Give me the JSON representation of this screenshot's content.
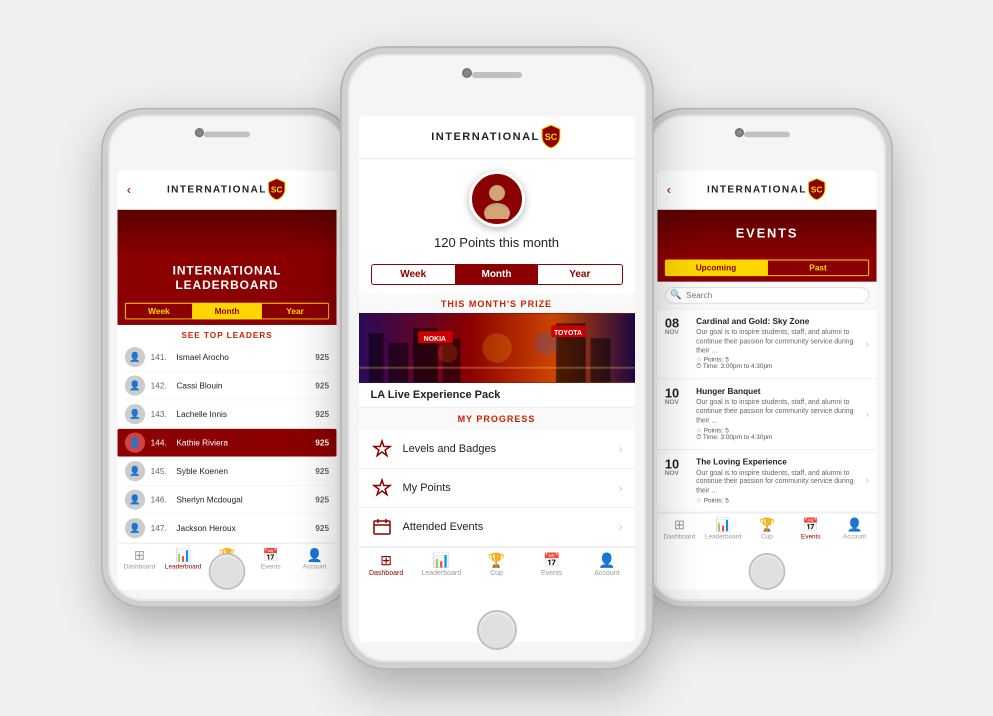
{
  "left_phone": {
    "header": {
      "title": "INTERNATIONAL",
      "back": "‹"
    },
    "hero": {
      "line1": "INTERNATIONAL",
      "line2": "LEADERBOARD"
    },
    "tabs": [
      {
        "label": "Week",
        "active": false
      },
      {
        "label": "Month",
        "active": true
      },
      {
        "label": "Year",
        "active": false
      }
    ],
    "see_leaders": "SEE TOP LEADERS",
    "leaders": [
      {
        "rank": "141.",
        "name": "Ismael Arocho",
        "points": "925",
        "highlighted": false
      },
      {
        "rank": "142.",
        "name": "Cassi Blouin",
        "points": "925",
        "highlighted": false
      },
      {
        "rank": "143.",
        "name": "Lachelle Innis",
        "points": "925",
        "highlighted": false
      },
      {
        "rank": "144.",
        "name": "Kathie Riviera",
        "points": "925",
        "highlighted": true
      },
      {
        "rank": "145.",
        "name": "Syble Koenen",
        "points": "925",
        "highlighted": false
      },
      {
        "rank": "146.",
        "name": "Sherlyn Mcdougal",
        "points": "925",
        "highlighted": false
      },
      {
        "rank": "147.",
        "name": "Jackson Heroux",
        "points": "925",
        "highlighted": false
      }
    ],
    "nav": [
      {
        "icon": "⊞",
        "label": "Dashboard",
        "active": false
      },
      {
        "icon": "📊",
        "label": "Leaderboard",
        "active": true
      },
      {
        "icon": "🏆",
        "label": "Cup",
        "active": false
      },
      {
        "icon": "📅",
        "label": "Events",
        "active": false
      },
      {
        "icon": "👤",
        "label": "Account",
        "active": false
      }
    ]
  },
  "center_phone": {
    "header": {
      "title": "INTERNATIONAL"
    },
    "points_text": "120 Points this month",
    "tabs": [
      {
        "label": "Week",
        "active": false
      },
      {
        "label": "Month",
        "active": true
      },
      {
        "label": "Year",
        "active": false
      }
    ],
    "prize_section_label": "THIS MONTH'S PRIZE",
    "prize_name": "LA Live Experience Pack",
    "progress_section_label": "MY PROGRESS",
    "progress_items": [
      {
        "icon": "⭐",
        "label": "Levels and Badges"
      },
      {
        "icon": "⭐",
        "label": "My Points"
      },
      {
        "icon": "📅",
        "label": "Attended Events"
      }
    ],
    "nav": [
      {
        "icon": "⊞",
        "label": "Dashboard",
        "active": true
      },
      {
        "icon": "📊",
        "label": "Leaderboard",
        "active": false
      },
      {
        "icon": "🏆",
        "label": "Cup",
        "active": false
      },
      {
        "icon": "📅",
        "label": "Events",
        "active": false
      },
      {
        "icon": "👤",
        "label": "Account",
        "active": false
      }
    ]
  },
  "right_phone": {
    "header": {
      "title": "INTERNATIONAL",
      "back": "‹"
    },
    "hero_title": "EVENTS",
    "tabs": [
      {
        "label": "Upcoming",
        "active": true
      },
      {
        "label": "Past",
        "active": false
      }
    ],
    "search_placeholder": "Search",
    "events": [
      {
        "day": "08",
        "month": "NOV",
        "title": "Cardinal and Gold: Sky Zone",
        "desc": "Our goal is to inspire students, staff, and alumni to continue their passion for community service during their ...",
        "points": "Points: 5",
        "time": "Time: 3:00pm to 4:30pm"
      },
      {
        "day": "10",
        "month": "NOV",
        "title": "Hunger Banquet",
        "desc": "Our goal is to inspire students, staff, and alumni to continue their passion for community service during their ...",
        "points": "Points: 5",
        "time": "Time: 3:00pm to 4:30pm"
      },
      {
        "day": "10",
        "month": "NOV",
        "title": "The Loving Experience",
        "desc": "Our goal is to inspire students, staff, and alumni to continue their passion for community service during their ...",
        "points": "Points: 5",
        "time": ""
      }
    ],
    "nav": [
      {
        "icon": "⊞",
        "label": "Dashboard",
        "active": false
      },
      {
        "icon": "📊",
        "label": "Leaderboard",
        "active": false
      },
      {
        "icon": "🏆",
        "label": "Cup",
        "active": false
      },
      {
        "icon": "📅",
        "label": "Events",
        "active": true
      },
      {
        "icon": "👤",
        "label": "Account",
        "active": false
      }
    ]
  }
}
